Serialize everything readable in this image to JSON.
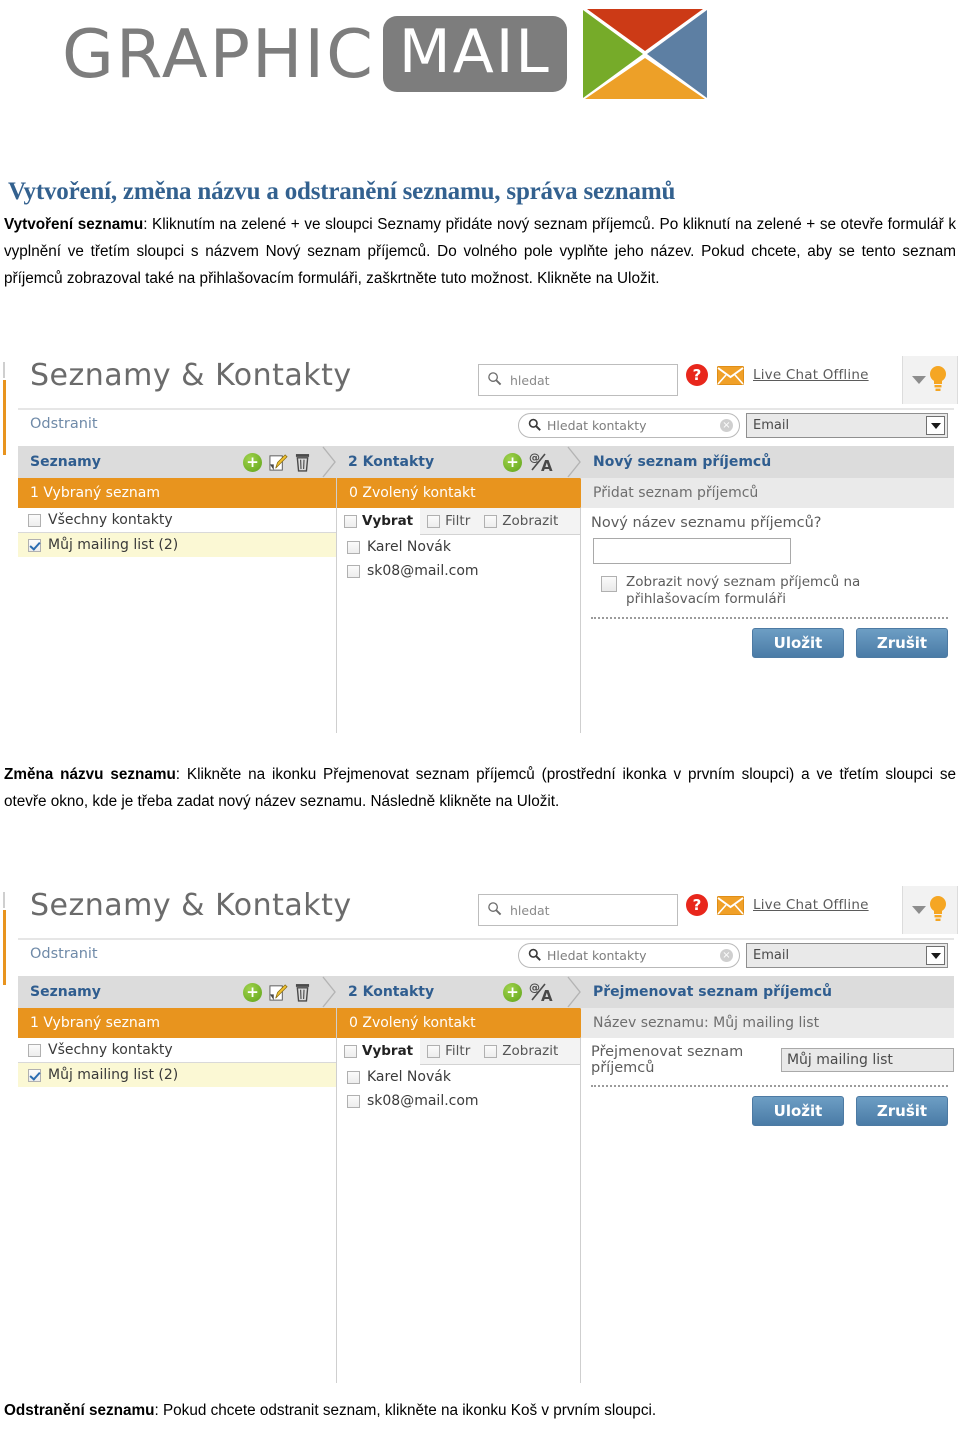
{
  "brand": {
    "logo_text_1": "GRAPHIC",
    "logo_text_2": "MAIL",
    "logo_icon": "envelope-icon",
    "colors": {
      "logo_grey": "#7d7d7d",
      "env_green": "#76ab29",
      "env_red": "#cc3a16",
      "env_blue": "#5d7fa3",
      "env_orange": "#eda028",
      "heading_blue": "#33618f",
      "accent_orange": "#e8941e",
      "button_blue": "#4a7ba6",
      "plus_green": "#6fae22",
      "help_red": "#e8271c"
    }
  },
  "document": {
    "title": "Vytvoření, změna názvu a odstranění seznamu, správa seznamů",
    "paragraph_1_bold": "Vytvoření seznamu",
    "paragraph_1_text": ": Kliknutím na zelené + ve sloupci Seznamy přidáte nový seznam příjemců. Po kliknutí na zelené + se otevře formulář k vyplnění ve třetím sloupci s názvem Nový seznam příjemců. Do volného pole vyplňte jeho název. Pokud chcete, aby se tento seznam příjemců zobrazoval také na přihlašovacím formuláři, zaškrtněte tuto možnost.  Klikněte na Uložit.",
    "paragraph_2_bold": "Změna názvu seznamu",
    "paragraph_2_text": ": Klikněte na ikonku Přejmenovat seznam příjemců (prostřední ikonka v prvním sloupci) a ve třetím sloupci se otevře okno, kde je třeba zadat nový název seznamu. Následně klikněte na Uložit.",
    "paragraph_3_bold": "Odstranění seznamu",
    "paragraph_3_text": ": Pokud chcete odstranit seznam, klikněte na ikonku Koš v prvním sloupci."
  },
  "screenshot_1": {
    "header": {
      "title": "Seznamy & Kontakty",
      "search_placeholder": "hledat",
      "search_icon": "search-icon",
      "help_icon": "help-icon",
      "help_glyph": "?",
      "mail_icon": "envelope-icon",
      "live_chat": "Live Chat Offline",
      "tip_icon": "lightbulb-icon",
      "caret_icon": "chevron-down-icon"
    },
    "toolbar": {
      "delete_label": "Odstranit",
      "contact_search_placeholder": "Hledat kontakty",
      "contact_search_icon": "search-icon",
      "clear_icon": "clear-icon",
      "filter_select_value": "Email",
      "select_arrow_icon": "chevron-down-icon"
    },
    "breadcrumbs": [
      {
        "label": "Seznamy",
        "icons": [
          "add-list-icon",
          "rename-list-icon",
          "delete-list-icon"
        ]
      },
      {
        "label": "2  Kontakty",
        "icons": [
          "add-contact-icon",
          "import-contacts-icon"
        ]
      },
      {
        "label": "Nový seznam příjemců",
        "icons": []
      }
    ],
    "column_lists": {
      "status_bar": "1 Vybraný seznam",
      "items": [
        {
          "label": "Všechny kontakty",
          "checked": false
        },
        {
          "label": "Můj mailing list (2)",
          "checked": true
        }
      ]
    },
    "column_contacts": {
      "status_bar": "0 Zvolený kontakt",
      "tabs": [
        {
          "label": "Vybrat",
          "active": true
        },
        {
          "label": "Filtr",
          "active": false
        },
        {
          "label": "Zobrazit",
          "active": false
        }
      ],
      "items": [
        {
          "label": "Karel Novák",
          "checked": false
        },
        {
          "label": "sk08@mail.com",
          "checked": false
        }
      ]
    },
    "column_form": {
      "status_bar": "Přidat seznam příjemců",
      "field_label": "Nový název seznamu příjemců?",
      "field_value": "",
      "checkbox_label": "Zobrazit nový seznam příjemců na přihlašovacím formuláři",
      "checkbox_checked": false,
      "save_label": "Uložit",
      "cancel_label": "Zrušit"
    }
  },
  "screenshot_2": {
    "header": {
      "title": "Seznamy & Kontakty",
      "search_placeholder": "hledat",
      "search_icon": "search-icon",
      "help_icon": "help-icon",
      "help_glyph": "?",
      "mail_icon": "envelope-icon",
      "live_chat": "Live Chat Offline",
      "tip_icon": "lightbulb-icon",
      "caret_icon": "chevron-down-icon"
    },
    "toolbar": {
      "delete_label": "Odstranit",
      "contact_search_placeholder": "Hledat kontakty",
      "contact_search_icon": "search-icon",
      "clear_icon": "clear-icon",
      "filter_select_value": "Email",
      "select_arrow_icon": "chevron-down-icon"
    },
    "breadcrumbs": [
      {
        "label": "Seznamy",
        "icons": [
          "add-list-icon",
          "rename-list-icon",
          "delete-list-icon"
        ]
      },
      {
        "label": "2  Kontakty",
        "icons": [
          "add-contact-icon",
          "import-contacts-icon"
        ]
      },
      {
        "label": "Přejmenovat seznam příjemců",
        "icons": []
      }
    ],
    "column_lists": {
      "status_bar": "1 Vybraný seznam",
      "items": [
        {
          "label": "Všechny kontakty",
          "checked": false
        },
        {
          "label": "Můj mailing list (2)",
          "checked": true
        }
      ]
    },
    "column_contacts": {
      "status_bar": "0 Zvolený kontakt",
      "tabs": [
        {
          "label": "Vybrat",
          "active": true
        },
        {
          "label": "Filtr",
          "active": false
        },
        {
          "label": "Zobrazit",
          "active": false
        }
      ],
      "items": [
        {
          "label": "Karel Novák",
          "checked": false
        },
        {
          "label": "sk08@mail.com",
          "checked": false
        }
      ]
    },
    "column_form": {
      "status_bar": "Název seznamu: Můj mailing list",
      "field_label": "Přejmenovat seznam příjemců",
      "field_value": "Můj mailing list",
      "save_label": "Uložit",
      "cancel_label": "Zrušit"
    }
  }
}
